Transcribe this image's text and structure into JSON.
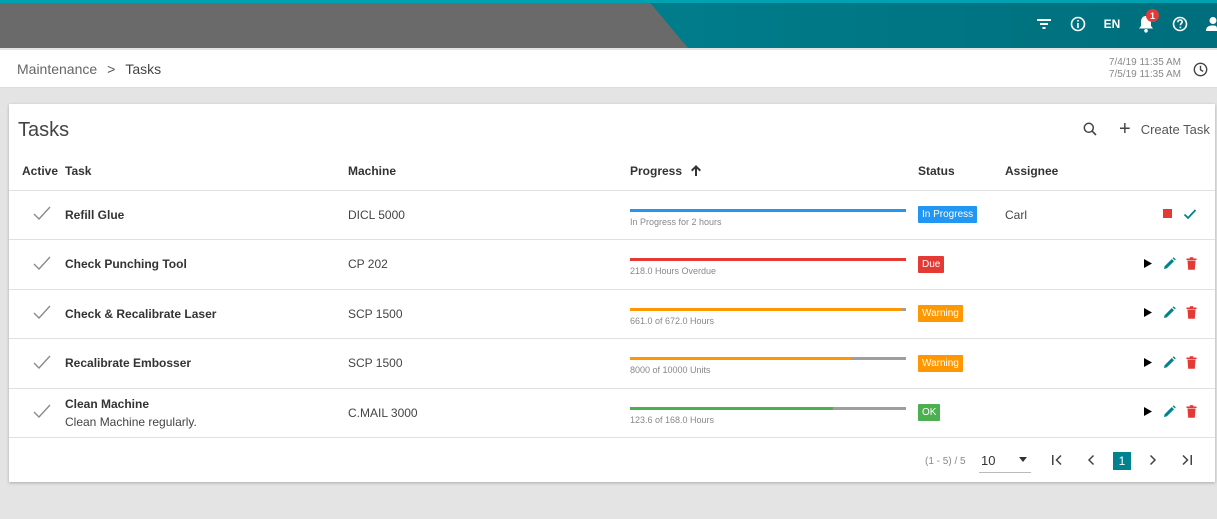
{
  "header": {
    "language": "EN",
    "notification_count": "1",
    "icons": [
      "filter-icon",
      "info-icon",
      "bell-icon",
      "help-icon",
      "user-icon"
    ]
  },
  "breadcrumb": {
    "parent": "Maintenance",
    "separator": ">",
    "current": "Tasks"
  },
  "time_range": {
    "from": "7/4/19 11:35 AM",
    "to": "7/5/19 11:35 AM"
  },
  "card": {
    "title": "Tasks",
    "create_label": "Create Task"
  },
  "table": {
    "columns": {
      "active": "Active",
      "task": "Task",
      "machine": "Machine",
      "progress": "Progress",
      "status": "Status",
      "assignee": "Assignee"
    },
    "rows": [
      {
        "task": "Refill Glue",
        "subtitle": "",
        "machine": "DICL 5000",
        "progress_text": "In Progress for 2 hours",
        "progress_fraction": 1.0,
        "progress_color": "#2196f3",
        "status": "In Progress",
        "status_color": "#2196f3",
        "assignee": "Carl",
        "actions": [
          "stop",
          "complete"
        ]
      },
      {
        "task": "Check Punching Tool",
        "subtitle": "",
        "machine": "CP 202",
        "progress_text": "218.0 Hours Overdue",
        "progress_fraction": 1.0,
        "progress_color": "#e53935",
        "status": "Due",
        "status_color": "#e53935",
        "assignee": "",
        "actions": [
          "start",
          "edit",
          "delete"
        ]
      },
      {
        "task": "Check & Recalibrate Laser",
        "subtitle": "",
        "machine": "SCP 1500",
        "progress_text": "661.0 of 672.0 Hours",
        "progress_fraction": 0.984,
        "progress_color": "#ff9800",
        "status": "Warning",
        "status_color": "#ff9800",
        "assignee": "",
        "actions": [
          "start",
          "edit",
          "delete"
        ]
      },
      {
        "task": "Recalibrate Embosser",
        "subtitle": "",
        "machine": "SCP 1500",
        "progress_text": "8000 of 10000 Units",
        "progress_fraction": 0.8,
        "progress_color": "#ff9800",
        "status": "Warning",
        "status_color": "#ff9800",
        "assignee": "",
        "actions": [
          "start",
          "edit",
          "delete"
        ]
      },
      {
        "task": "Clean Machine",
        "subtitle": "Clean Machine regularly.",
        "machine": "C.MAIL 3000",
        "progress_text": "123.6 of 168.0 Hours",
        "progress_fraction": 0.736,
        "progress_color": "#4caf50",
        "status": "OK",
        "status_color": "#4caf50",
        "assignee": "",
        "actions": [
          "start",
          "edit",
          "delete"
        ]
      }
    ]
  },
  "pagination": {
    "range": "(1 - 5) / 5",
    "page_size": "10",
    "current_page": "1"
  },
  "colors": {
    "accent": "#00838f",
    "stop": "#e53935",
    "complete": "#00838f",
    "edit": "#00838f",
    "delete": "#e53935"
  }
}
